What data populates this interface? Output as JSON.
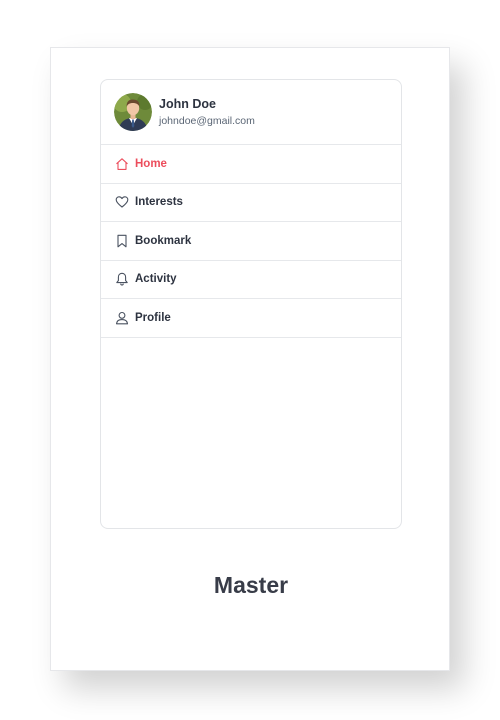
{
  "user": {
    "name": "John Doe",
    "email": "johndoe@gmail.com"
  },
  "menu": {
    "items": [
      {
        "label": "Home",
        "icon": "home-icon",
        "active": true
      },
      {
        "label": "Interests",
        "icon": "heart-icon",
        "active": false
      },
      {
        "label": "Bookmark",
        "icon": "bookmark-icon",
        "active": false
      },
      {
        "label": "Activity",
        "icon": "bell-icon",
        "active": false
      },
      {
        "label": "Profile",
        "icon": "user-icon",
        "active": false
      }
    ]
  },
  "caption": "Master",
  "colors": {
    "accent": "#ec4d5c",
    "text": "#2d3340",
    "muted": "#5b6675",
    "border": "#e6e8eb"
  }
}
